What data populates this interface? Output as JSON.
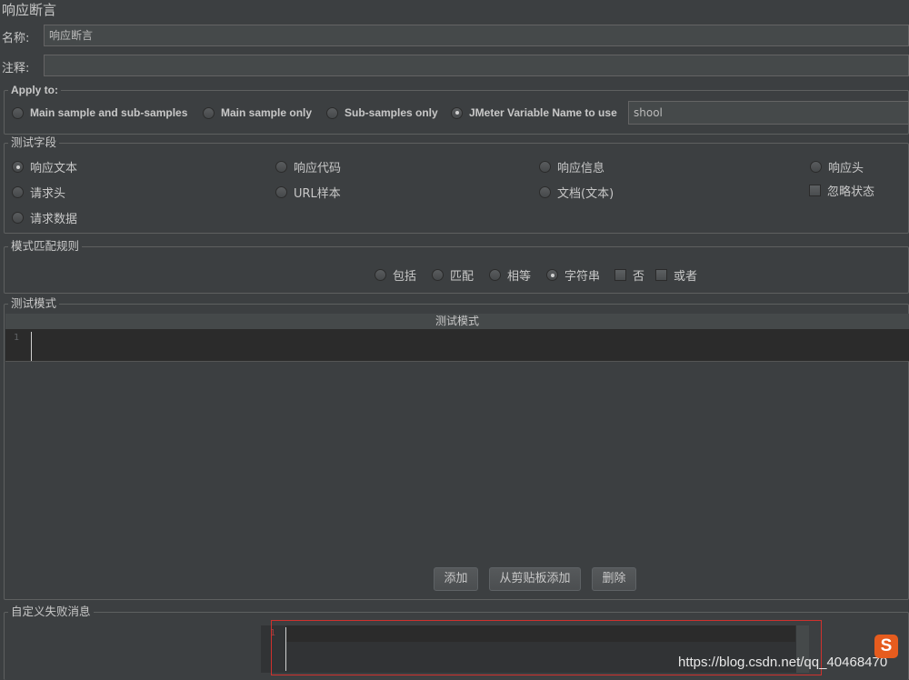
{
  "page_title": "响应断言",
  "name_field": {
    "label": "名称:",
    "value": "响应断言"
  },
  "comment_field": {
    "label": "注释:",
    "value": ""
  },
  "apply_to": {
    "legend": "Apply to:",
    "options": [
      {
        "label": "Main sample and sub-samples",
        "selected": false
      },
      {
        "label": "Main sample only",
        "selected": false
      },
      {
        "label": "Sub-samples only",
        "selected": false
      },
      {
        "label": "JMeter Variable Name to use",
        "selected": true
      }
    ],
    "variable_name": "shool"
  },
  "test_field": {
    "legend": "测试字段",
    "options": [
      {
        "label": "响应文本",
        "selected": true
      },
      {
        "label": "响应代码",
        "selected": false
      },
      {
        "label": "响应信息",
        "selected": false
      },
      {
        "label": "响应头",
        "selected": false
      },
      {
        "label": "请求头",
        "selected": false
      },
      {
        "label": "URL样本",
        "selected": false
      },
      {
        "label": "文档(文本)",
        "selected": false
      },
      {
        "label": "请求数据",
        "selected": false
      }
    ],
    "ignore_status": {
      "label": "忽略状态",
      "checked": false
    }
  },
  "pattern_rules": {
    "legend": "模式匹配规则",
    "radios": [
      {
        "label": "包括",
        "selected": false
      },
      {
        "label": "匹配",
        "selected": false
      },
      {
        "label": "相等",
        "selected": false
      },
      {
        "label": "字符串",
        "selected": true
      }
    ],
    "checks": [
      {
        "label": "否",
        "checked": false
      },
      {
        "label": "或者",
        "checked": false
      }
    ]
  },
  "test_patterns": {
    "legend": "测试模式",
    "column_header": "测试模式",
    "rows": [
      {
        "line": "1",
        "text": ""
      }
    ],
    "buttons": {
      "add": "添加",
      "add_clipboard": "从剪贴板添加",
      "delete": "删除"
    }
  },
  "custom_failure": {
    "legend": "自定义失败消息",
    "line": "1"
  },
  "watermark": {
    "text": "https://blog.csdn.net/qq_40468470",
    "logo": "S"
  }
}
